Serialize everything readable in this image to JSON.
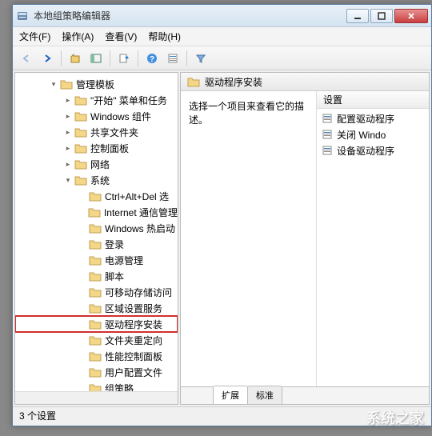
{
  "window": {
    "title": "本地组策略编辑器"
  },
  "menubar": {
    "file": "文件(F)",
    "action": "操作(A)",
    "view": "查看(V)",
    "help": "帮助(H)"
  },
  "tree": {
    "root": "管理模板",
    "items": [
      {
        "label": "\"开始\" 菜单和任务",
        "expanded": false,
        "level": 3
      },
      {
        "label": "Windows 组件",
        "expanded": false,
        "level": 3
      },
      {
        "label": "共享文件夹",
        "expanded": false,
        "level": 3
      },
      {
        "label": "控制面板",
        "expanded": false,
        "level": 3
      },
      {
        "label": "网络",
        "expanded": false,
        "level": 3
      },
      {
        "label": "系统",
        "expanded": true,
        "level": 3
      },
      {
        "label": "Ctrl+Alt+Del 选",
        "expanded": false,
        "level": 4
      },
      {
        "label": "Internet 通信管理",
        "expanded": false,
        "level": 4
      },
      {
        "label": "Windows 热启动",
        "expanded": false,
        "level": 4
      },
      {
        "label": "登录",
        "expanded": false,
        "level": 4
      },
      {
        "label": "电源管理",
        "expanded": false,
        "level": 4
      },
      {
        "label": "脚本",
        "expanded": false,
        "level": 4
      },
      {
        "label": "可移动存储访问",
        "expanded": false,
        "level": 4
      },
      {
        "label": "区域设置服务",
        "expanded": false,
        "level": 4
      },
      {
        "label": "驱动程序安装",
        "expanded": false,
        "level": 4,
        "highlighted": true
      },
      {
        "label": "文件夹重定向",
        "expanded": false,
        "level": 4
      },
      {
        "label": "性能控制面板",
        "expanded": false,
        "level": 4
      },
      {
        "label": "用户配置文件",
        "expanded": false,
        "level": 4
      },
      {
        "label": "组策略",
        "expanded": false,
        "level": 4
      }
    ]
  },
  "right": {
    "header": "驱动程序安装",
    "description": "选择一个项目来查看它的描述。",
    "column_header": "设置",
    "settings": [
      "配置驱动程序",
      "关闭 Windo",
      "设备驱动程序"
    ]
  },
  "tabs": {
    "extended": "扩展",
    "standard": "标准"
  },
  "statusbar": {
    "text": "3 个设置"
  },
  "watermark": "系统之家",
  "colors": {
    "highlight_border": "#d03030",
    "window_border": "#5a7ca0",
    "close_btn": "#c84040"
  }
}
